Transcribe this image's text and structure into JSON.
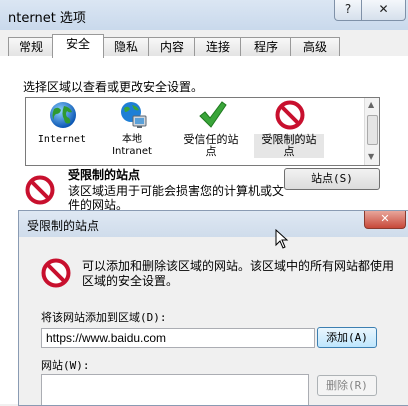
{
  "outer_window": {
    "title": "nternet 选项",
    "help_label": "?",
    "close_label": "✕"
  },
  "tabs": [
    {
      "label": "常规"
    },
    {
      "label": "安全",
      "active": true
    },
    {
      "label": "隐私"
    },
    {
      "label": "内容"
    },
    {
      "label": "连接"
    },
    {
      "label": "程序"
    },
    {
      "label": "高级"
    }
  ],
  "security": {
    "instruction": "选择区域以查看或更改安全设置。",
    "zones": [
      {
        "label": "Internet",
        "icon": "globe-icon"
      },
      {
        "label": "本地\nIntranet",
        "icon": "local-intranet-icon"
      },
      {
        "label": "受信任的站\n点",
        "icon": "trusted-sites-check-icon"
      },
      {
        "label": "受限制的站\n点",
        "icon": "restricted-sites-icon",
        "selected": true
      }
    ],
    "selected_zone_title": "受限制的站点",
    "selected_zone_description": "该区域适用于可能会损害您的计算机或文件的网站。",
    "sites_button": "站点(S)"
  },
  "dialog": {
    "title": "受限制的站点",
    "close_label": "✕",
    "message": "可以添加和删除该区域的网站。该区域中的所有网站都使用区域的安全设置。",
    "add_label": "将该网站添加到区域(D):",
    "url_value": "https://www.baidu.com",
    "add_button": "添加(A)",
    "websites_label": "网站(W):",
    "remove_button": "删除(R)"
  },
  "colors": {
    "restricted_red": "#c8102e",
    "trusted_green": "#3aa53a",
    "titlebar": "#d5e1ef"
  }
}
